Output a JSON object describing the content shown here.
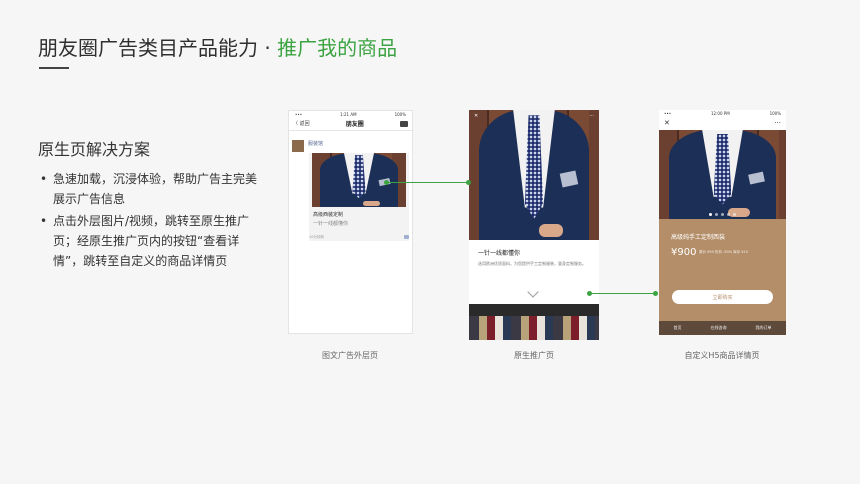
{
  "title": {
    "main": "朋友圈广告类目产品能力 · ",
    "accent": "推广我的商品"
  },
  "subtitle": "原生页解决方案",
  "bullets": [
    "急速加载，沉浸体验，帮助广告主完美展示广告信息",
    "点击外层图片/视频，跳转至原生推广页；经原生推广页内的按钮“查看详情”，跳转至自定义的商品详情页"
  ],
  "phone1": {
    "status_time": "1:21 AM",
    "status_batt": "100%",
    "back": "〈 返回",
    "nav_title": "朋友圈",
    "account": "服装馆",
    "card_title": "高级西装定制",
    "card_desc": "一针一线都懂你",
    "time": "10分钟前"
  },
  "phone2": {
    "close": "✕",
    "more": "···",
    "heading": "一针一线都懂你",
    "body": "选用欧洲优质面料，为您提供手工定制服装，量身定制服务。"
  },
  "phone3": {
    "status_time": "12:00 PM",
    "status_batt": "100%",
    "close": "✕",
    "more": "···",
    "product_title": "高级纯手工定制西装",
    "price": "¥900",
    "meta": "原价 ¥99  折扣 -90%  库存 ¥15",
    "buy": "立即购买",
    "tabs": [
      "首页",
      "在线咨询",
      "我的订单"
    ]
  },
  "captions": [
    "图文广告外层页",
    "原生推广页",
    "自定义H5商品详情页"
  ],
  "colors": {
    "accent": "#3ba341",
    "detail_bg": "#b48e68"
  }
}
